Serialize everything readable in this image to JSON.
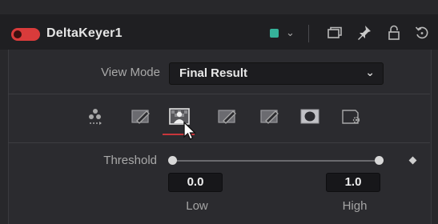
{
  "header": {
    "title": "DeltaKeyer1",
    "node_color": "#35b29a",
    "icons": [
      "color-chevron-down-icon",
      "window-icon",
      "pin-icon",
      "lock-icon",
      "reset-icon"
    ]
  },
  "view_mode": {
    "label": "View Mode",
    "value": "Final Result"
  },
  "tabs": [
    {
      "name": "keyer-tab",
      "active": false
    },
    {
      "name": "pre-matte-tab",
      "active": false
    },
    {
      "name": "matte-tab",
      "active": true
    },
    {
      "name": "fine-matte-tab",
      "active": false
    },
    {
      "name": "clean-plate-tab",
      "active": false
    },
    {
      "name": "mask-tab",
      "active": false
    },
    {
      "name": "settings-tab",
      "active": false
    }
  ],
  "threshold": {
    "label": "Threshold",
    "low": "0.0",
    "high": "1.0",
    "low_label": "Low",
    "high_label": "High"
  }
}
